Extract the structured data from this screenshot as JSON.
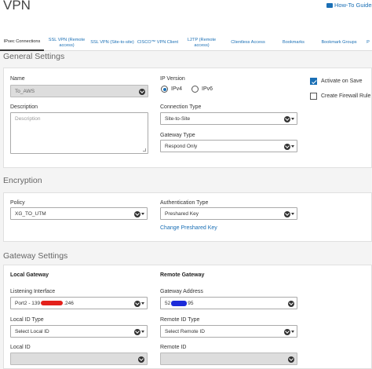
{
  "page": {
    "title": "VPN"
  },
  "help_link": {
    "label": "How-To Guides"
  },
  "tabs": [
    {
      "label": "IPsec Connections"
    },
    {
      "label": "SSL VPN (Remote access)"
    },
    {
      "label": "SSL VPN (Site-to-site)"
    },
    {
      "label": "CISCO™ VPN Client"
    },
    {
      "label": "L2TP (Remote access)"
    },
    {
      "label": "Clientless Access"
    },
    {
      "label": "Bookmarks"
    },
    {
      "label": "Bookmark Groups"
    },
    {
      "label": "P"
    }
  ],
  "general": {
    "title": "General Settings",
    "name_label": "Name",
    "name_value": "To_AWS",
    "description_label": "Description",
    "description_placeholder": "Description",
    "ip_version_label": "IP Version",
    "ipv4_label": "IPv4",
    "ipv6_label": "IPv6",
    "ip_version_selected": "IPv4",
    "connection_type_label": "Connection Type",
    "connection_type_value": "Site-to-Site",
    "gateway_type_label": "Gateway Type",
    "gateway_type_value": "Respond Only",
    "activate_on_save_label": "Activate on Save",
    "activate_on_save_checked": true,
    "create_firewall_rule_label": "Create Firewall Rule",
    "create_firewall_rule_checked": false
  },
  "encryption": {
    "title": "Encryption",
    "policy_label": "Policy",
    "policy_value": "XG_TO_UTM",
    "auth_type_label": "Authentication Type",
    "auth_type_value": "Preshared Key",
    "change_key_link": "Change Preshared Key"
  },
  "gateway": {
    "title": "Gateway Settings",
    "local_heading": "Local Gateway",
    "remote_heading": "Remote Gateway",
    "listening_interface_label": "Listening Interface",
    "listening_interface_prefix": "Port2 - 139",
    "listening_interface_suffix": ".246",
    "gateway_address_label": "Gateway Address",
    "gateway_address_prefix": "52",
    "gateway_address_suffix": "95",
    "local_id_type_label": "Local ID Type",
    "local_id_type_value": "Select Local ID",
    "remote_id_type_label": "Remote ID Type",
    "remote_id_type_value": "Select Remote ID",
    "local_id_label": "Local ID",
    "remote_id_label": "Remote ID"
  },
  "colors": {
    "accent": "#1a6fb5",
    "redaction_red": "#e3201b",
    "redaction_blue": "#1c2bd9"
  }
}
